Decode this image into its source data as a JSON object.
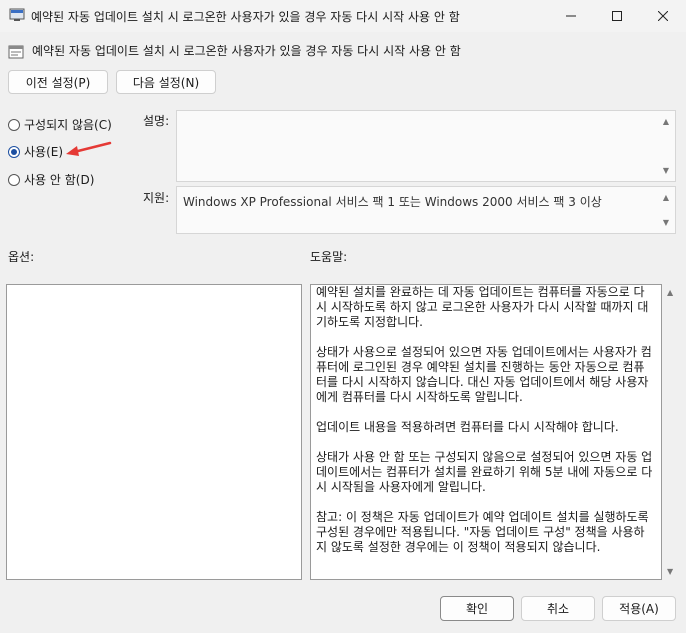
{
  "window": {
    "title": "예약된 자동 업데이트 설치 시 로그온한 사용자가 있을 경우 자동 다시 시작 사용 안 함",
    "minimize_icon": "minimize-icon",
    "maximize_icon": "maximize-icon",
    "close_icon": "close-icon"
  },
  "header": {
    "policy_title": "예약된 자동 업데이트 설치 시 로그온한 사용자가 있을 경우 자동 다시 시작 사용 안 함",
    "prev_label": "이전 설정(P)",
    "next_label": "다음 설정(N)"
  },
  "state": {
    "options": [
      {
        "label": "구성되지 않음(C)",
        "checked": false
      },
      {
        "label": "사용(E)",
        "checked": true
      },
      {
        "label": "사용 안 함(D)",
        "checked": false
      }
    ]
  },
  "comment": {
    "label": "설명:",
    "value": ""
  },
  "supported": {
    "label": "지원:",
    "value": "Windows XP Professional 서비스 팩 1 또는 Windows 2000 서비스 팩 3 이상"
  },
  "options_label": "옵션:",
  "help": {
    "label": "도움말:",
    "paragraphs": [
      "예약된 설치를 완료하는 데 자동 업데이트는 컴퓨터를 자동으로 다시 시작하도록 하지 않고 로그온한 사용자가 다시 시작할 때까지 대기하도록 지정합니다.",
      "상태가 사용으로 설정되어 있으면 자동 업데이트에서는 사용자가 컴퓨터에 로그인된 경우 예약된 설치를 진행하는 동안 자동으로 컴퓨터를 다시 시작하지 않습니다. 대신 자동 업데이트에서 해당 사용자에게 컴퓨터를 다시 시작하도록 알립니다.",
      "업데이트 내용을 적용하려면 컴퓨터를 다시 시작해야 합니다.",
      "상태가 사용 안 함 또는 구성되지 않음으로 설정되어 있으면 자동 업데이트에서는 컴퓨터가 설치를 완료하기 위해 5분 내에 자동으로 다시 시작됨을 사용자에게 알립니다.",
      "참고: 이 정책은 자동 업데이트가 예약 업데이트 설치를 실행하도록 구성된 경우에만 적용됩니다. \"자동 업데이트 구성\" 정책을 사용하지 않도록 설정한 경우에는 이 정책이 적용되지 않습니다."
    ]
  },
  "footer": {
    "ok_label": "확인",
    "cancel_label": "취소",
    "apply_label": "적용(A)"
  },
  "colors": {
    "accent": "#1c4fa1",
    "annotation_arrow": "#e53935"
  }
}
